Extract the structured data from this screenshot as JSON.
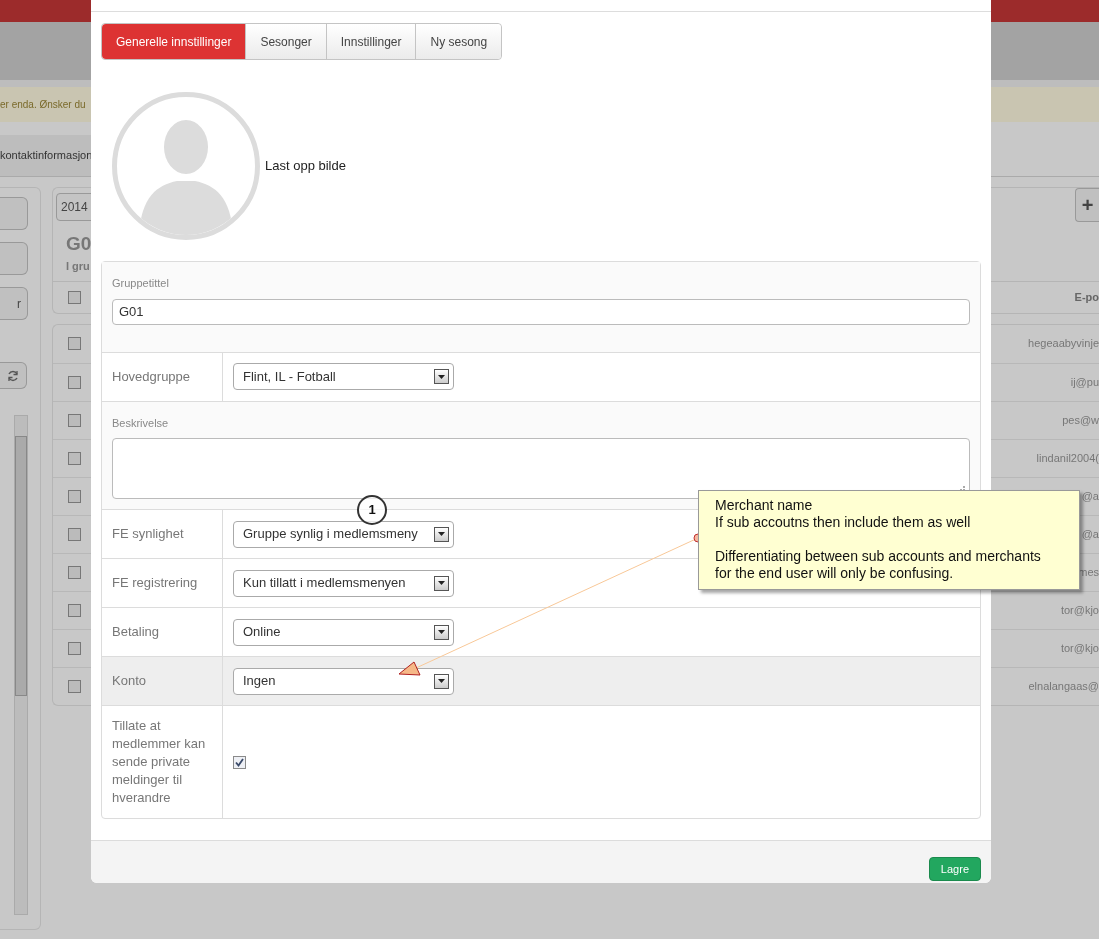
{
  "background_page": {
    "alert_text": "er enda. Ønsker du",
    "tab_label": "kontaktinformasjon",
    "side_button_label": "r",
    "year_select": "2014",
    "add_button": "+",
    "group_heading": "G0",
    "group_subtitle": "I gru",
    "column_header": "E-po",
    "header_checked": false,
    "rows": [
      {
        "email": "hegeaabyvinje",
        "checked": false
      },
      {
        "email": "ij@pu",
        "checked": false
      },
      {
        "email": "pes@w",
        "checked": false
      },
      {
        "email": "lindanil2004(",
        "checked": false
      },
      {
        "email": "@a",
        "checked": false
      },
      {
        "email": "@a",
        "checked": false
      },
      {
        "email": "mes",
        "checked": false
      },
      {
        "email": "tor@kjo",
        "checked": false
      },
      {
        "email": "tor@kjo",
        "checked": false
      },
      {
        "email": "elnalangaas@",
        "checked": false
      }
    ]
  },
  "modal": {
    "tabs": [
      {
        "label": "Generelle innstillinger",
        "selected": true
      },
      {
        "label": "Sesonger",
        "selected": false
      },
      {
        "label": "Innstillinger",
        "selected": false
      },
      {
        "label": "Ny sesong",
        "selected": false
      }
    ],
    "upload_label": "Last opp bilde",
    "form_rows": [
      {
        "kind": "text",
        "label": "Gruppetittel",
        "value": "G01",
        "highlighted": false
      },
      {
        "kind": "select",
        "label": "Hovedgruppe",
        "value": "Flint, IL - Fotball",
        "highlighted": false
      },
      {
        "kind": "textarea",
        "label": "Beskrivelse",
        "highlighted": false
      },
      {
        "kind": "select",
        "label": "FE synlighet",
        "value": "Gruppe synlig i medlemsmeny",
        "highlighted": false
      },
      {
        "kind": "select",
        "label": "FE registrering",
        "value": "Kun tillatt i medlemsmenyen",
        "highlighted": false
      },
      {
        "kind": "select",
        "label": "Betaling",
        "value": "Online",
        "highlighted": false
      },
      {
        "kind": "select",
        "label": "Konto",
        "value": "Ingen",
        "highlighted": true
      },
      {
        "kind": "checkbox",
        "label": "Tillate at medlemmer kan sende private meldinger til hverandre",
        "checked": true,
        "highlighted": false
      }
    ],
    "save_button": "Lagre"
  },
  "annotation": {
    "number": "1",
    "paragraphs": [
      "Merchant name\nIf sub accoutns then include them as well",
      "Differentiating between sub accounts and merchants\nfor the end user will only be confusing."
    ]
  }
}
